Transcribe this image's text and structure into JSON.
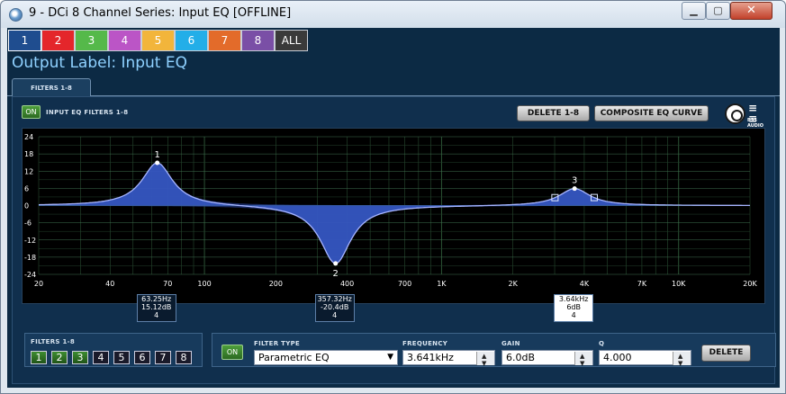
{
  "window": {
    "title": "9 - DCi 8 Channel Series: Input EQ [OFFLINE]",
    "min_label": "▁",
    "max_label": "▢",
    "close_label": "✕"
  },
  "channel_tabs": [
    {
      "label": "1",
      "color": "#1f4d8f",
      "selected": true
    },
    {
      "label": "2",
      "color": "#e4262b"
    },
    {
      "label": "3",
      "color": "#55b94a"
    },
    {
      "label": "4",
      "color": "#bb55c6"
    },
    {
      "label": "5",
      "color": "#f2b53b"
    },
    {
      "label": "6",
      "color": "#23aee8"
    },
    {
      "label": "7",
      "color": "#e36b2a"
    },
    {
      "label": "8",
      "color": "#7a4fa6"
    },
    {
      "label": "ALL",
      "color": "#3a3a3a"
    }
  ],
  "output_label": "Output Label: Input EQ",
  "filters_tab": "FILTERS 1-8",
  "top": {
    "on_label": "ON",
    "eq_label": "INPUT EQ FILTERS 1-8",
    "delete_label": "DELETE 1-8",
    "composite_label": "COMPOSITE EQ CURVE",
    "logo_text": "BSS AUDIO"
  },
  "chart_data": {
    "type": "line",
    "xscale": "log",
    "xlim": [
      20,
      20000
    ],
    "ylim": [
      -24,
      24
    ],
    "grid": true,
    "y_ticks": [
      "24",
      "18",
      "12",
      "6",
      "0",
      "-6",
      "-12",
      "-18",
      "-24"
    ],
    "x_ticks": [
      {
        "v": 20,
        "label": "20"
      },
      {
        "v": 40,
        "label": "40"
      },
      {
        "v": 70,
        "label": "70"
      },
      {
        "v": 100,
        "label": "100"
      },
      {
        "v": 200,
        "label": "200"
      },
      {
        "v": 400,
        "label": "400"
      },
      {
        "v": 700,
        "label": "700"
      },
      {
        "v": 1000,
        "label": "1K"
      },
      {
        "v": 2000,
        "label": "2K"
      },
      {
        "v": 4000,
        "label": "4K"
      },
      {
        "v": 7000,
        "label": "7K"
      },
      {
        "v": 10000,
        "label": "10K"
      },
      {
        "v": 20000,
        "label": "20K"
      }
    ],
    "filters": [
      {
        "label": "1",
        "freq": 63.25,
        "gain": 15.12,
        "q": 4
      },
      {
        "label": "2",
        "freq": 357.32,
        "gain": -20.4,
        "q": 4
      },
      {
        "label": "3",
        "freq": 3641,
        "gain": 6,
        "q": 4
      }
    ],
    "readouts": [
      {
        "freq": "63.25Hz",
        "gain": "15.12dB",
        "q": "4"
      },
      {
        "freq": "357.32Hz",
        "gain": "-20.4dB",
        "q": "4"
      },
      {
        "freq": "3.64kHz",
        "gain": "6dB",
        "q": "4"
      }
    ],
    "fill_color": "#3c5fc8",
    "curve_color": "#a6b4ff"
  },
  "bottom": {
    "filters_label": "FILTERS 1-8",
    "filter_buttons": [
      {
        "label": "1",
        "active": true
      },
      {
        "label": "2",
        "active": true
      },
      {
        "label": "3",
        "active": true
      },
      {
        "label": "4",
        "active": false
      },
      {
        "label": "5",
        "active": false
      },
      {
        "label": "6",
        "active": false
      },
      {
        "label": "7",
        "active": false
      },
      {
        "label": "8",
        "active": false
      }
    ],
    "on_label": "ON",
    "filter_type_label": "FILTER TYPE",
    "filter_type_value": "Parametric EQ",
    "frequency_label": "FREQUENCY",
    "frequency_value": "3.641kHz",
    "gain_label": "GAIN",
    "gain_value": "6.0dB",
    "q_label": "Q",
    "q_value": "4.000",
    "delete_label": "DELETE"
  }
}
